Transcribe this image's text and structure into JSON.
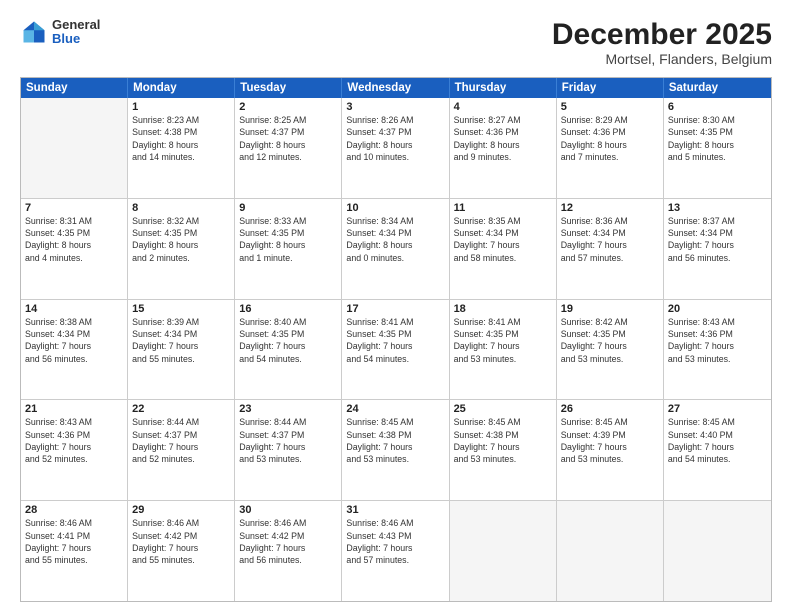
{
  "header": {
    "logo": {
      "general": "General",
      "blue": "Blue"
    },
    "title": "December 2025",
    "subtitle": "Mortsel, Flanders, Belgium"
  },
  "days": [
    "Sunday",
    "Monday",
    "Tuesday",
    "Wednesday",
    "Thursday",
    "Friday",
    "Saturday"
  ],
  "weeks": [
    [
      {
        "day": "",
        "empty": true,
        "lines": []
      },
      {
        "day": "1",
        "lines": [
          "Sunrise: 8:23 AM",
          "Sunset: 4:38 PM",
          "Daylight: 8 hours",
          "and 14 minutes."
        ]
      },
      {
        "day": "2",
        "lines": [
          "Sunrise: 8:25 AM",
          "Sunset: 4:37 PM",
          "Daylight: 8 hours",
          "and 12 minutes."
        ]
      },
      {
        "day": "3",
        "lines": [
          "Sunrise: 8:26 AM",
          "Sunset: 4:37 PM",
          "Daylight: 8 hours",
          "and 10 minutes."
        ]
      },
      {
        "day": "4",
        "lines": [
          "Sunrise: 8:27 AM",
          "Sunset: 4:36 PM",
          "Daylight: 8 hours",
          "and 9 minutes."
        ]
      },
      {
        "day": "5",
        "lines": [
          "Sunrise: 8:29 AM",
          "Sunset: 4:36 PM",
          "Daylight: 8 hours",
          "and 7 minutes."
        ]
      },
      {
        "day": "6",
        "lines": [
          "Sunrise: 8:30 AM",
          "Sunset: 4:35 PM",
          "Daylight: 8 hours",
          "and 5 minutes."
        ]
      }
    ],
    [
      {
        "day": "7",
        "lines": [
          "Sunrise: 8:31 AM",
          "Sunset: 4:35 PM",
          "Daylight: 8 hours",
          "and 4 minutes."
        ]
      },
      {
        "day": "8",
        "lines": [
          "Sunrise: 8:32 AM",
          "Sunset: 4:35 PM",
          "Daylight: 8 hours",
          "and 2 minutes."
        ]
      },
      {
        "day": "9",
        "lines": [
          "Sunrise: 8:33 AM",
          "Sunset: 4:35 PM",
          "Daylight: 8 hours",
          "and 1 minute."
        ]
      },
      {
        "day": "10",
        "lines": [
          "Sunrise: 8:34 AM",
          "Sunset: 4:34 PM",
          "Daylight: 8 hours",
          "and 0 minutes."
        ]
      },
      {
        "day": "11",
        "lines": [
          "Sunrise: 8:35 AM",
          "Sunset: 4:34 PM",
          "Daylight: 7 hours",
          "and 58 minutes."
        ]
      },
      {
        "day": "12",
        "lines": [
          "Sunrise: 8:36 AM",
          "Sunset: 4:34 PM",
          "Daylight: 7 hours",
          "and 57 minutes."
        ]
      },
      {
        "day": "13",
        "lines": [
          "Sunrise: 8:37 AM",
          "Sunset: 4:34 PM",
          "Daylight: 7 hours",
          "and 56 minutes."
        ]
      }
    ],
    [
      {
        "day": "14",
        "lines": [
          "Sunrise: 8:38 AM",
          "Sunset: 4:34 PM",
          "Daylight: 7 hours",
          "and 56 minutes."
        ]
      },
      {
        "day": "15",
        "lines": [
          "Sunrise: 8:39 AM",
          "Sunset: 4:34 PM",
          "Daylight: 7 hours",
          "and 55 minutes."
        ]
      },
      {
        "day": "16",
        "lines": [
          "Sunrise: 8:40 AM",
          "Sunset: 4:35 PM",
          "Daylight: 7 hours",
          "and 54 minutes."
        ]
      },
      {
        "day": "17",
        "lines": [
          "Sunrise: 8:41 AM",
          "Sunset: 4:35 PM",
          "Daylight: 7 hours",
          "and 54 minutes."
        ]
      },
      {
        "day": "18",
        "lines": [
          "Sunrise: 8:41 AM",
          "Sunset: 4:35 PM",
          "Daylight: 7 hours",
          "and 53 minutes."
        ]
      },
      {
        "day": "19",
        "lines": [
          "Sunrise: 8:42 AM",
          "Sunset: 4:35 PM",
          "Daylight: 7 hours",
          "and 53 minutes."
        ]
      },
      {
        "day": "20",
        "lines": [
          "Sunrise: 8:43 AM",
          "Sunset: 4:36 PM",
          "Daylight: 7 hours",
          "and 53 minutes."
        ]
      }
    ],
    [
      {
        "day": "21",
        "lines": [
          "Sunrise: 8:43 AM",
          "Sunset: 4:36 PM",
          "Daylight: 7 hours",
          "and 52 minutes."
        ]
      },
      {
        "day": "22",
        "lines": [
          "Sunrise: 8:44 AM",
          "Sunset: 4:37 PM",
          "Daylight: 7 hours",
          "and 52 minutes."
        ]
      },
      {
        "day": "23",
        "lines": [
          "Sunrise: 8:44 AM",
          "Sunset: 4:37 PM",
          "Daylight: 7 hours",
          "and 53 minutes."
        ]
      },
      {
        "day": "24",
        "lines": [
          "Sunrise: 8:45 AM",
          "Sunset: 4:38 PM",
          "Daylight: 7 hours",
          "and 53 minutes."
        ]
      },
      {
        "day": "25",
        "lines": [
          "Sunrise: 8:45 AM",
          "Sunset: 4:38 PM",
          "Daylight: 7 hours",
          "and 53 minutes."
        ]
      },
      {
        "day": "26",
        "lines": [
          "Sunrise: 8:45 AM",
          "Sunset: 4:39 PM",
          "Daylight: 7 hours",
          "and 53 minutes."
        ]
      },
      {
        "day": "27",
        "lines": [
          "Sunrise: 8:45 AM",
          "Sunset: 4:40 PM",
          "Daylight: 7 hours",
          "and 54 minutes."
        ]
      }
    ],
    [
      {
        "day": "28",
        "lines": [
          "Sunrise: 8:46 AM",
          "Sunset: 4:41 PM",
          "Daylight: 7 hours",
          "and 55 minutes."
        ]
      },
      {
        "day": "29",
        "lines": [
          "Sunrise: 8:46 AM",
          "Sunset: 4:42 PM",
          "Daylight: 7 hours",
          "and 55 minutes."
        ]
      },
      {
        "day": "30",
        "lines": [
          "Sunrise: 8:46 AM",
          "Sunset: 4:42 PM",
          "Daylight: 7 hours",
          "and 56 minutes."
        ]
      },
      {
        "day": "31",
        "lines": [
          "Sunrise: 8:46 AM",
          "Sunset: 4:43 PM",
          "Daylight: 7 hours",
          "and 57 minutes."
        ]
      },
      {
        "day": "",
        "empty": true,
        "lines": []
      },
      {
        "day": "",
        "empty": true,
        "lines": []
      },
      {
        "day": "",
        "empty": true,
        "lines": []
      }
    ]
  ]
}
